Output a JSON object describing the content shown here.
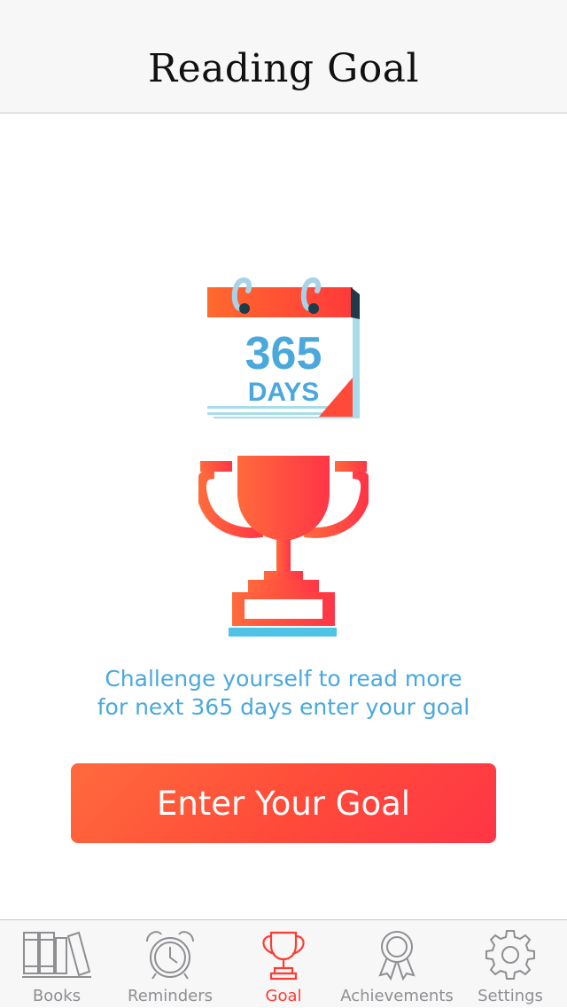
{
  "header": {
    "title": "Reading Goal"
  },
  "illustration": {
    "calendar_number": "365",
    "calendar_unit": "DAYS"
  },
  "challenge": {
    "line1": "Challenge yourself to read more",
    "line2": "for next 365 days enter your goal"
  },
  "cta": {
    "label": "Enter Your Goal"
  },
  "tabbar": {
    "items": [
      {
        "label": "Books",
        "icon": "books-icon"
      },
      {
        "label": "Reminders",
        "icon": "alarm-clock-icon"
      },
      {
        "label": "Goal",
        "icon": "trophy-icon",
        "active": true
      },
      {
        "label": "Achievements",
        "icon": "award-ribbon-icon"
      },
      {
        "label": "Settings",
        "icon": "gear-icon"
      }
    ]
  },
  "colors": {
    "accent": "#ff3b30",
    "accent_orange": "#ff6a3c",
    "text_blue": "#4aa8dc",
    "tab_inactive": "#8e8e93"
  }
}
